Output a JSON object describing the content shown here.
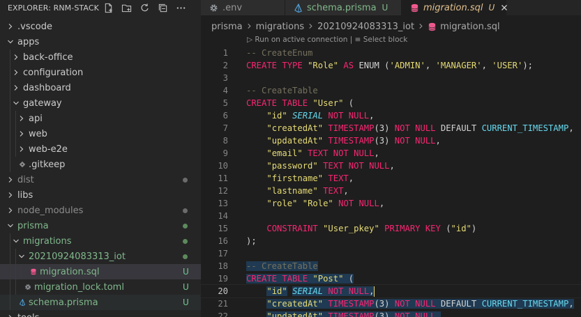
{
  "explorer": {
    "title": "EXPLORER: RNM-STACK",
    "actions": [
      "new-file-icon",
      "new-folder-icon",
      "refresh-icon",
      "collapse-all-icon",
      "more-actions-icon"
    ],
    "tree": [
      {
        "label": ".vscode",
        "type": "folder",
        "expanded": false,
        "depth": 0
      },
      {
        "label": "apps",
        "type": "folder",
        "expanded": true,
        "depth": 0
      },
      {
        "label": "back-office",
        "type": "folder",
        "expanded": false,
        "depth": 1
      },
      {
        "label": "configuration",
        "type": "folder",
        "expanded": false,
        "depth": 1
      },
      {
        "label": "dashboard",
        "type": "folder",
        "expanded": false,
        "depth": 1
      },
      {
        "label": "gateway",
        "type": "folder",
        "expanded": true,
        "depth": 1
      },
      {
        "label": "api",
        "type": "folder",
        "expanded": false,
        "depth": 2
      },
      {
        "label": "web",
        "type": "folder",
        "expanded": false,
        "depth": 2
      },
      {
        "label": "web-e2e",
        "type": "folder",
        "expanded": false,
        "depth": 2
      },
      {
        "label": ".gitkeep",
        "type": "file",
        "icon": "gitkeep-icon",
        "depth": 1
      },
      {
        "label": "dist",
        "type": "folder",
        "expanded": false,
        "depth": 0,
        "muted": true,
        "dot": "#6b6b6b"
      },
      {
        "label": "libs",
        "type": "folder",
        "expanded": false,
        "depth": 0
      },
      {
        "label": "node_modules",
        "type": "folder",
        "expanded": false,
        "depth": 0,
        "muted": true,
        "dot": "#6b6b6b"
      },
      {
        "label": "prisma",
        "type": "folder",
        "expanded": true,
        "depth": 0,
        "green": true,
        "dot": "#5c8a5c"
      },
      {
        "label": "migrations",
        "type": "folder",
        "expanded": true,
        "depth": 1,
        "green": true,
        "dot": "#5c8a5c"
      },
      {
        "label": "20210924083313_iot",
        "type": "folder",
        "expanded": true,
        "depth": 2,
        "green": true,
        "dot": "#5c8a5c"
      },
      {
        "label": "migration.sql",
        "type": "file",
        "icon": "database-icon",
        "depth": 3,
        "green": true,
        "status": "U",
        "selected": true
      },
      {
        "label": "migration_lock.toml",
        "type": "file",
        "icon": "gear-icon",
        "depth": 2,
        "green": true,
        "status": "U"
      },
      {
        "label": "schema.prisma",
        "type": "file",
        "icon": "prisma-icon",
        "depth": 1,
        "green": true,
        "status": "U",
        "active": true
      },
      {
        "label": "tools",
        "type": "folder",
        "expanded": false,
        "depth": 0
      }
    ]
  },
  "tabs": [
    {
      "label": ".env",
      "icon": "gear-icon",
      "state": "inactive"
    },
    {
      "label": "schema.prisma",
      "icon": "prisma-icon",
      "state": "inactive",
      "status": "U"
    },
    {
      "label": "migration.sql",
      "icon": "database-icon",
      "state": "active",
      "status": "U"
    }
  ],
  "breadcrumbs": [
    "prisma",
    "migrations",
    "20210924083313_iot",
    "migration.sql"
  ],
  "codelens": "▷ Run on active connection | ≡ Select block",
  "current_line": 20,
  "code": [
    {
      "n": "1",
      "tokens": [
        [
          "cm",
          "-- CreateEnum"
        ]
      ]
    },
    {
      "n": "2",
      "tokens": [
        [
          "kw",
          "CREATE TYPE "
        ],
        [
          "str",
          "\"Role\""
        ],
        [
          "kw",
          " AS "
        ],
        [
          "pl",
          "ENUM ("
        ],
        [
          "str",
          "'ADMIN'"
        ],
        [
          "pl",
          ", "
        ],
        [
          "str",
          "'MANAGER'"
        ],
        [
          "pl",
          ", "
        ],
        [
          "str",
          "'USER'"
        ],
        [
          "pl",
          ");"
        ]
      ]
    },
    {
      "n": "3",
      "tokens": []
    },
    {
      "n": "4",
      "tokens": [
        [
          "cm",
          "-- CreateTable"
        ]
      ]
    },
    {
      "n": "5",
      "tokens": [
        [
          "kw",
          "CREATE TABLE "
        ],
        [
          "str",
          "\"User\""
        ],
        [
          "pl",
          " ("
        ]
      ]
    },
    {
      "n": "6",
      "tokens": [
        [
          "pl",
          "    "
        ],
        [
          "str",
          "\"id\""
        ],
        [
          "pl",
          " "
        ],
        [
          "typ",
          "SERIAL"
        ],
        [
          "kw",
          " NOT NULL"
        ],
        [
          "pl",
          ","
        ]
      ]
    },
    {
      "n": "7",
      "tokens": [
        [
          "pl",
          "    "
        ],
        [
          "str",
          "\"createdAt\""
        ],
        [
          "kw",
          " TIMESTAMP"
        ],
        [
          "pl",
          "(3)"
        ],
        [
          "kw",
          " NOT NULL"
        ],
        [
          "pl",
          " DEFAULT "
        ],
        [
          "fn",
          "CURRENT_TIMESTAMP"
        ],
        [
          "pl",
          ","
        ]
      ]
    },
    {
      "n": "8",
      "tokens": [
        [
          "pl",
          "    "
        ],
        [
          "str",
          "\"updatedAt\""
        ],
        [
          "kw",
          " TIMESTAMP"
        ],
        [
          "pl",
          "(3)"
        ],
        [
          "kw",
          " NOT NULL"
        ],
        [
          "pl",
          ","
        ]
      ]
    },
    {
      "n": "9",
      "tokens": [
        [
          "pl",
          "    "
        ],
        [
          "str",
          "\"email\""
        ],
        [
          "kw",
          " TEXT NOT NULL"
        ],
        [
          "pl",
          ","
        ]
      ]
    },
    {
      "n": "10",
      "tokens": [
        [
          "pl",
          "    "
        ],
        [
          "str",
          "\"password\""
        ],
        [
          "kw",
          " TEXT NOT NULL"
        ],
        [
          "pl",
          ","
        ]
      ]
    },
    {
      "n": "11",
      "tokens": [
        [
          "pl",
          "    "
        ],
        [
          "str",
          "\"firstname\""
        ],
        [
          "kw",
          " TEXT"
        ],
        [
          "pl",
          ","
        ]
      ]
    },
    {
      "n": "12",
      "tokens": [
        [
          "pl",
          "    "
        ],
        [
          "str",
          "\"lastname\""
        ],
        [
          "kw",
          " TEXT"
        ],
        [
          "pl",
          ","
        ]
      ]
    },
    {
      "n": "13",
      "tokens": [
        [
          "pl",
          "    "
        ],
        [
          "str",
          "\"role\""
        ],
        [
          "pl",
          " "
        ],
        [
          "str",
          "\"Role\""
        ],
        [
          "kw",
          " NOT NULL"
        ],
        [
          "pl",
          ","
        ]
      ]
    },
    {
      "n": "14",
      "tokens": []
    },
    {
      "n": "15",
      "tokens": [
        [
          "pl",
          "    "
        ],
        [
          "kw",
          "CONSTRAINT "
        ],
        [
          "str",
          "\"User_pkey\""
        ],
        [
          "kw",
          " PRIMARY KEY "
        ],
        [
          "pl",
          "("
        ],
        [
          "str",
          "\"id\""
        ],
        [
          "pl",
          ")"
        ]
      ]
    },
    {
      "n": "16",
      "tokens": [
        [
          "pl",
          ");"
        ]
      ]
    },
    {
      "n": "17",
      "tokens": []
    },
    {
      "n": "18",
      "tokens": [
        [
          "cm",
          "-- CreateTable"
        ]
      ],
      "hl": "soft"
    },
    {
      "n": "19",
      "tokens": [
        [
          "kw",
          "CREATE TABLE "
        ],
        [
          "str",
          "\"Post\""
        ],
        [
          "pl",
          " ("
        ]
      ],
      "hl": "soft"
    },
    {
      "n": "20",
      "tokens": [
        [
          "pl",
          "    "
        ],
        [
          "str",
          "\"id\""
        ],
        [
          "pl",
          " "
        ],
        [
          "typ",
          "SERIAL"
        ],
        [
          "kw",
          " NOT NULL"
        ],
        [
          "pl",
          ","
        ]
      ],
      "hl": "soft",
      "cursor": true
    },
    {
      "n": "21",
      "tokens": [
        [
          "pl",
          "    "
        ],
        [
          "str",
          "\"createdAt\""
        ],
        [
          "kw",
          " TIMESTAMP"
        ],
        [
          "pl",
          "(3)"
        ],
        [
          "kw",
          " NOT NULL"
        ],
        [
          "pl",
          " DEFAULT "
        ],
        [
          "fn",
          "CURRENT_TIMESTAMP"
        ],
        [
          "pl",
          ","
        ]
      ],
      "hl": "soft"
    },
    {
      "n": "22",
      "tokens": [
        [
          "pl",
          "    "
        ],
        [
          "str",
          "\"updatedAt\""
        ],
        [
          "kw",
          " TIMESTAMP"
        ],
        [
          "pl",
          "(3)"
        ],
        [
          "kw",
          " NOT NULL"
        ],
        [
          "pl",
          ","
        ]
      ],
      "hl": "soft"
    }
  ],
  "colors": {
    "untracked": "#73c991",
    "untracked_text": "#81b88b",
    "modified_tab": "#e2c08d",
    "sidebar_bg": "#252526",
    "editor_bg": "#1e1e1e"
  }
}
